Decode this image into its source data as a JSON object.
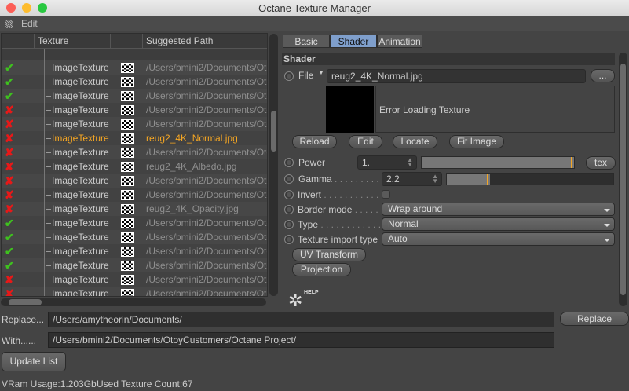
{
  "window": {
    "title": "Octane Texture Manager"
  },
  "menu": {
    "edit": "Edit"
  },
  "colors": {
    "accent": "#f5a623",
    "ok": "#3fc11f",
    "error": "#e81818",
    "tab_active": "#7f9fcc"
  },
  "tree": {
    "columns": [
      "",
      "Texture",
      "",
      "Suggested Path"
    ],
    "rows": [
      {
        "status": "ok",
        "texture": "ImageTexture",
        "path": "/Users/bmini2/Documents/Oto"
      },
      {
        "status": "ok",
        "texture": "ImageTexture",
        "path": "/Users/bmini2/Documents/Oto"
      },
      {
        "status": "ok",
        "texture": "ImageTexture",
        "path": "/Users/bmini2/Documents/Oto"
      },
      {
        "status": "error",
        "texture": "ImageTexture",
        "path": "/Users/bmini2/Documents/Oto"
      },
      {
        "status": "error",
        "texture": "ImageTexture",
        "path": "/Users/bmini2/Documents/Oto"
      },
      {
        "status": "error",
        "texture": "ImageTexture",
        "path": "reug2_4K_Normal.jpg",
        "selected": true
      },
      {
        "status": "error",
        "texture": "ImageTexture",
        "path": "/Users/bmini2/Documents/Oto"
      },
      {
        "status": "error",
        "texture": "ImageTexture",
        "path": "reug2_4K_Albedo.jpg"
      },
      {
        "status": "error",
        "texture": "ImageTexture",
        "path": "/Users/bmini2/Documents/Oto"
      },
      {
        "status": "error",
        "texture": "ImageTexture",
        "path": "/Users/bmini2/Documents/Oto"
      },
      {
        "status": "error",
        "texture": "ImageTexture",
        "path": "reug2_4K_Opacity.jpg"
      },
      {
        "status": "ok",
        "texture": "ImageTexture",
        "path": "/Users/bmini2/Documents/Oto"
      },
      {
        "status": "ok",
        "texture": "ImageTexture",
        "path": "/Users/bmini2/Documents/Oto"
      },
      {
        "status": "ok",
        "texture": "ImageTexture",
        "path": "/Users/bmini2/Documents/Oto"
      },
      {
        "status": "ok",
        "texture": "ImageTexture",
        "path": "/Users/bmini2/Documents/Oto"
      },
      {
        "status": "error",
        "texture": "ImageTexture",
        "path": "/Users/bmini2/Documents/Oto"
      },
      {
        "status": "error",
        "texture": "ImageTexture",
        "path": "/Users/bmini2/Documents/Oto"
      }
    ]
  },
  "tabs": [
    {
      "label": "Basic"
    },
    {
      "label": "Shader",
      "active": true
    },
    {
      "label": "Animation"
    }
  ],
  "shader": {
    "header": "Shader",
    "file_label": "File",
    "file_value": "reug2_4K_Normal.jpg",
    "browse": "...",
    "preview_message": "Error Loading Texture",
    "buttons": [
      "Reload",
      "Edit",
      "Locate",
      "Fit Image"
    ],
    "power": {
      "label": "Power",
      "value": "1.",
      "slider_fraction": 1.0,
      "tex": "tex"
    },
    "gamma": {
      "label": "Gamma",
      "dots": " . . . . . . . . . .",
      "value": "2.2",
      "slider_fraction": 0.26
    },
    "invert": {
      "label": "Invert",
      "dots": " . . . . . . . . . . . .",
      "checked": false
    },
    "border_mode": {
      "label": "Border mode",
      "dots": " . . . . . .",
      "value": "Wrap around"
    },
    "type": {
      "label": "Type",
      "dots": " . . . . . . . . . . . . .",
      "value": "Normal"
    },
    "import_type": {
      "label": "Texture import type",
      "value": "Auto"
    },
    "uv_transform": "UV Transform",
    "projection": "Projection",
    "help": "HELP"
  },
  "replace": {
    "label": "Replace...",
    "value": "/Users/amytheorin/Documents/",
    "button": "Replace"
  },
  "with": {
    "label": "With......",
    "value": "/Users/bmini2/Documents/OtoyCustomers/Octane Project/"
  },
  "update_button": "Update List",
  "status": {
    "vram": "VRam Usage:1.203Gb",
    "count": "Used Texture Count:67"
  }
}
